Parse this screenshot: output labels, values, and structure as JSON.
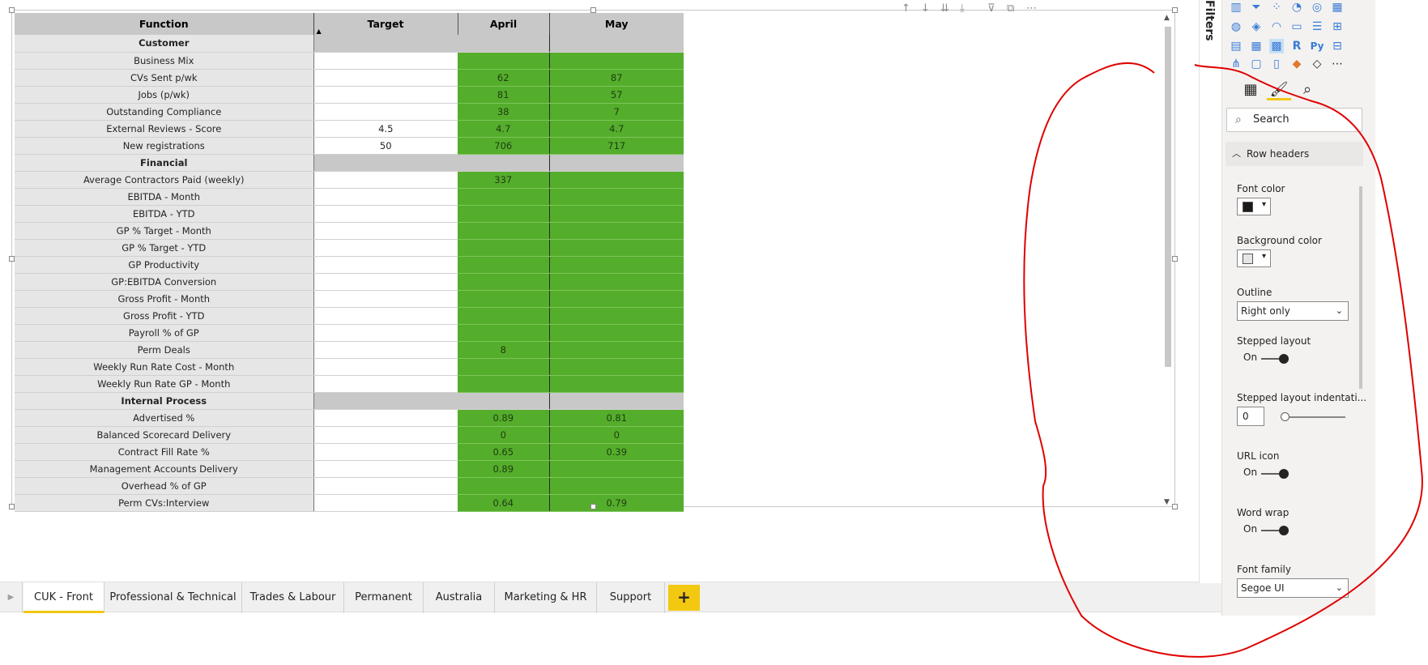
{
  "matrix": {
    "columns": [
      "Function",
      "Target",
      "April",
      "May"
    ],
    "rows": [
      {
        "type": "group",
        "label": "Customer"
      },
      {
        "type": "row",
        "label": "Business Mix",
        "target": "",
        "april": "",
        "may": ""
      },
      {
        "type": "row",
        "label": "CVs Sent p/wk",
        "target": "",
        "april": "62",
        "may": "87"
      },
      {
        "type": "row",
        "label": "Jobs (p/wk)",
        "target": "",
        "april": "81",
        "may": "57"
      },
      {
        "type": "row",
        "label": "Outstanding Compliance",
        "target": "",
        "april": "38",
        "may": "7"
      },
      {
        "type": "row",
        "label": "External Reviews - Score",
        "target": "4.5",
        "april": "4.7",
        "may": "4.7"
      },
      {
        "type": "row",
        "label": "New registrations",
        "target": "50",
        "april": "706",
        "may": "717"
      },
      {
        "type": "group",
        "label": "Financial"
      },
      {
        "type": "row",
        "label": "Average Contractors Paid (weekly)",
        "target": "",
        "april": "337",
        "may": ""
      },
      {
        "type": "row",
        "label": "EBITDA - Month",
        "target": "",
        "april": "",
        "may": ""
      },
      {
        "type": "row",
        "label": "EBITDA - YTD",
        "target": "",
        "april": "",
        "may": ""
      },
      {
        "type": "row",
        "label": "GP % Target - Month",
        "target": "",
        "april": "",
        "may": ""
      },
      {
        "type": "row",
        "label": "GP % Target - YTD",
        "target": "",
        "april": "",
        "may": ""
      },
      {
        "type": "row",
        "label": "GP Productivity",
        "target": "",
        "april": "",
        "may": ""
      },
      {
        "type": "row",
        "label": "GP:EBITDA Conversion",
        "target": "",
        "april": "",
        "may": ""
      },
      {
        "type": "row",
        "label": "Gross Profit - Month",
        "target": "",
        "april": "",
        "may": ""
      },
      {
        "type": "row",
        "label": "Gross Profit - YTD",
        "target": "",
        "april": "",
        "may": ""
      },
      {
        "type": "row",
        "label": "Payroll % of GP",
        "target": "",
        "april": "",
        "may": ""
      },
      {
        "type": "row",
        "label": "Perm Deals",
        "target": "",
        "april": "8",
        "may": ""
      },
      {
        "type": "row",
        "label": "Weekly Run Rate Cost - Month",
        "target": "",
        "april": "",
        "may": ""
      },
      {
        "type": "row",
        "label": "Weekly Run Rate GP - Month",
        "target": "",
        "april": "",
        "may": ""
      },
      {
        "type": "group",
        "label": "Internal Process"
      },
      {
        "type": "row",
        "label": "Advertised %",
        "target": "",
        "april": "0.89",
        "may": "0.81"
      },
      {
        "type": "row",
        "label": "Balanced Scorecard Delivery",
        "target": "",
        "april": "0",
        "may": "0"
      },
      {
        "type": "row",
        "label": "Contract Fill Rate %",
        "target": "",
        "april": "0.65",
        "may": "0.39"
      },
      {
        "type": "row",
        "label": "Management Accounts Delivery",
        "target": "",
        "april": "0.89",
        "may": ""
      },
      {
        "type": "row",
        "label": "Overhead % of GP",
        "target": "",
        "april": "",
        "may": ""
      },
      {
        "type": "row",
        "label": "Perm CVs:Interview",
        "target": "",
        "april": "0.64",
        "may": "0.79"
      }
    ]
  },
  "tabs": [
    "CUK - Front",
    "Professional & Technical",
    "Trades & Labour",
    "Permanent",
    "Australia",
    "Marketing & HR",
    "Support"
  ],
  "active_tab": "CUK - Front",
  "add_page_label": "+",
  "filters_label": "Filters",
  "pane": {
    "search_placeholder": "Search",
    "section": "Row headers",
    "font_color_label": "Font color",
    "font_color": "#1b1a19",
    "background_color_label": "Background color",
    "background_color": "#e6e6e6",
    "outline_label": "Outline",
    "outline_value": "Right only",
    "stepped_layout_label": "Stepped layout",
    "stepped_layout_value": "On",
    "stepped_indent_label": "Stepped layout indentati...",
    "stepped_indent_value": "0",
    "url_icon_label": "URL icon",
    "url_icon_value": "On",
    "word_wrap_label": "Word wrap",
    "word_wrap_value": "On",
    "font_family_label": "Font family",
    "font_family_value": "Segoe UI"
  },
  "colors": {
    "good": "#55ad2c",
    "header": "#c8c8c8",
    "row_header_bg": "#e6e6e6",
    "accent": "#f2c811",
    "annotation": "#e00000"
  }
}
